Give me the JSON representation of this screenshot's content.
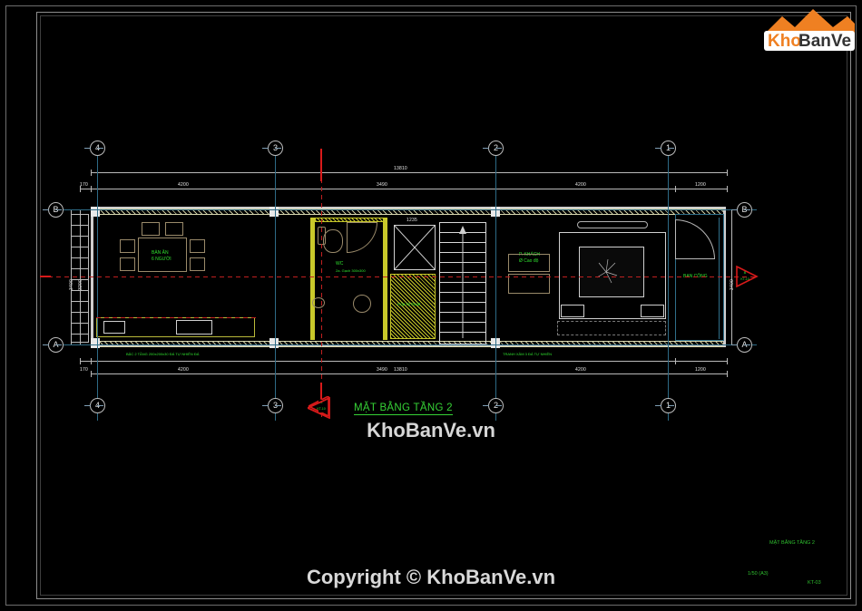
{
  "sheet": {
    "logo": {
      "text_a": "Kho",
      "text_b": "BanVe",
      "accent": "#ef8022",
      "dark": "#333333"
    },
    "watermark_center": "KhoBanVe.vn",
    "watermark_bottom": "Copyright © KhoBanVe.vn"
  },
  "plan": {
    "title": "MẶT BẰNG TẦNG 2",
    "grid_top": [
      "4",
      "3",
      "2",
      "1"
    ],
    "grid_bottom": [
      "4",
      "3",
      "2",
      "1"
    ],
    "grid_left": [
      "B",
      "A"
    ],
    "grid_right": [
      "B",
      "A"
    ],
    "dims_top": {
      "overall": "13810",
      "segments": [
        "170",
        "4200",
        "3490",
        "4200",
        "1200"
      ]
    },
    "dims_bottom": {
      "overall": "13810",
      "segments": [
        "170",
        "4200",
        "3490",
        "4200",
        "1200"
      ]
    },
    "dims_left": {
      "overall": "3400",
      "segments": [
        "3200"
      ]
    },
    "dims_right": {
      "overall": "3400",
      "segments": [
        "3300"
      ]
    },
    "rooms": [
      {
        "name": "dining-room",
        "line1": "BÀN ĂN",
        "line2": "6 NGƯỜI"
      },
      {
        "name": "wc",
        "line1": "WC",
        "line2": "2a. Gạch 300x300"
      },
      {
        "name": "stair-hall",
        "line1": "Hộp kỹ thuật",
        "line2": ""
      },
      {
        "name": "living-room",
        "line1": "P. KHÁCH",
        "line2": "Ø Cao độ"
      },
      {
        "name": "balcony",
        "line1": "BAN CÔNG",
        "line2": ""
      },
      {
        "name": "stair-size",
        "line1": "1235",
        "line2": ""
      }
    ],
    "notes": [
      {
        "name": "note-left",
        "text": "BẬC 2 TẦNG 200x200x30 ĐÁ TỰ NHIÊN ĐÁ"
      },
      {
        "name": "note-right",
        "text": "TRANH XÂM 3 ĐÁ TỰ NHIÊN"
      }
    ],
    "section_marks": [
      {
        "name": "section-a",
        "top": "A",
        "bottom": "KT-10"
      },
      {
        "name": "section-b",
        "top": "B",
        "bottom": "KT-10"
      }
    ]
  },
  "title_block": {
    "drawing_name": "MẶT BẰNG TẦNG 2",
    "scale": "1/50 (A3)",
    "sheet_no": "KT-03"
  }
}
